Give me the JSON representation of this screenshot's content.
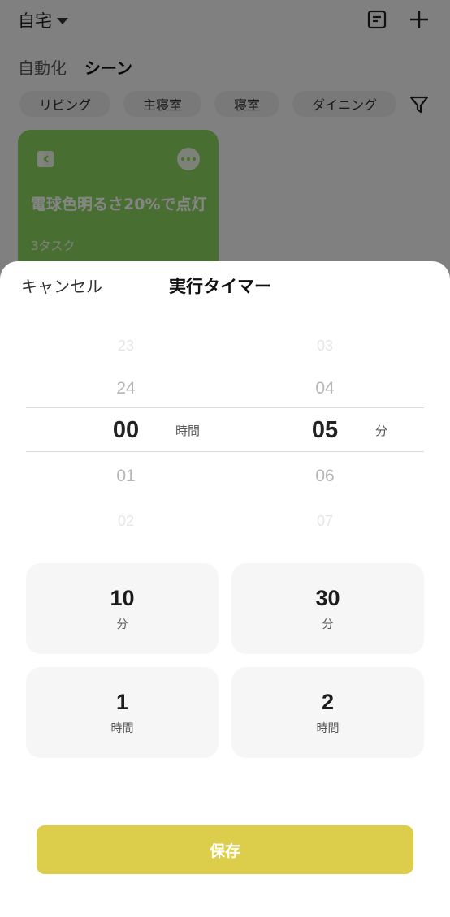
{
  "header": {
    "home_label": "自宅"
  },
  "tabs": {
    "automation": "自動化",
    "scene": "シーン"
  },
  "rooms": [
    "リビング",
    "主寝室",
    "寝室",
    "ダイニング"
  ],
  "scene_card": {
    "title": "電球色明るさ20%で点灯",
    "tasks": "3タスク",
    "color": "#8bd35f"
  },
  "sheet": {
    "cancel_label": "キャンセル",
    "title": "実行タイマー",
    "save_label": "保存"
  },
  "picker": {
    "hours": {
      "values": [
        "23",
        "24",
        "00",
        "01",
        "02"
      ],
      "selected": "00",
      "unit": "時間"
    },
    "minutes": {
      "values": [
        "03",
        "04",
        "05",
        "06",
        "07"
      ],
      "selected": "05",
      "unit": "分"
    }
  },
  "presets": [
    {
      "value": "10",
      "unit": "分"
    },
    {
      "value": "30",
      "unit": "分"
    },
    {
      "value": "1",
      "unit": "時間"
    },
    {
      "value": "2",
      "unit": "時間"
    }
  ],
  "colors": {
    "save_button": "#dccd4a",
    "accent_green": "#8bd35f"
  }
}
